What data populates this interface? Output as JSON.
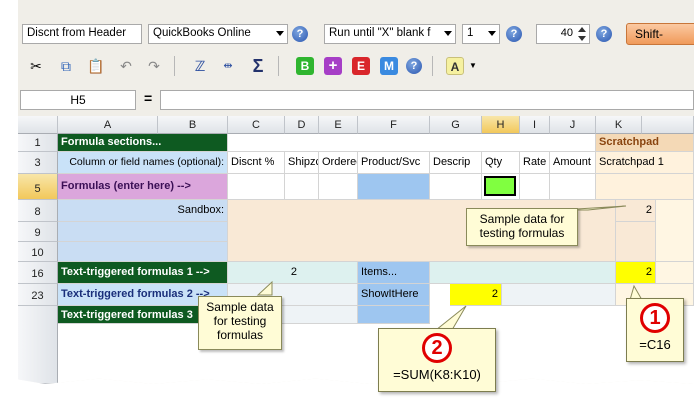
{
  "toolbar1": {
    "field_combo": "Discnt from Header",
    "app_combo": "QuickBooks Online",
    "run_combo": "Run until \"X\" blank f",
    "count_combo": "1",
    "spin_value": "40",
    "shift_button": "Shift-"
  },
  "toolbar2": {
    "btn_b": "B",
    "btn_plus": "+",
    "btn_e": "E",
    "btn_m": "M",
    "btn_a": "A"
  },
  "formula_bar": {
    "cell_ref": "H5",
    "equals": "=",
    "content": ""
  },
  "columns": [
    "A",
    "B",
    "C",
    "D",
    "E",
    "F",
    "G",
    "H",
    "I",
    "J",
    "K"
  ],
  "rows": [
    "1",
    "3",
    "5",
    "8",
    "9",
    "10",
    "16",
    "23"
  ],
  "cells": {
    "a1": "Formula sections...",
    "k1": "Scratchpad",
    "a3": "Column or field names  (optional):",
    "c3": "Discnt %",
    "d3": "Shipzc",
    "e3": "Orderec",
    "f3": "Product/Svc",
    "g3": "Descrip",
    "h3": "Qty",
    "i3": "Rate",
    "j3": "Amount",
    "k3": "Scratchpad 1",
    "a5": "Formulas (enter here) -->",
    "b8": "Sandbox:",
    "k8": "2",
    "a16": "Text-triggered formulas 1 -->",
    "c16": "2",
    "f16": "Items...",
    "k16": "2",
    "a23": "Text-triggered formulas 2 -->",
    "f23": "ShowItHere",
    "g23": "2",
    "a24": "Text-triggered formulas 3"
  },
  "callouts": {
    "sample_right": "Sample data for testing formulas",
    "sample_left": "Sample data for testing formulas",
    "num_2": "2",
    "formula_2": "=SUM(K8:K10)",
    "num_1": "1",
    "formula_1": "=C16"
  },
  "colors": {
    "dark_green": "#0e5a21",
    "violet": "#dba6dc",
    "blue_cells": "#9ec6f0",
    "orange_band": "#f9e9d6",
    "aqua_band": "#ddf1ef",
    "yellow": "#ffff00",
    "bright_green": "#80ff40"
  }
}
